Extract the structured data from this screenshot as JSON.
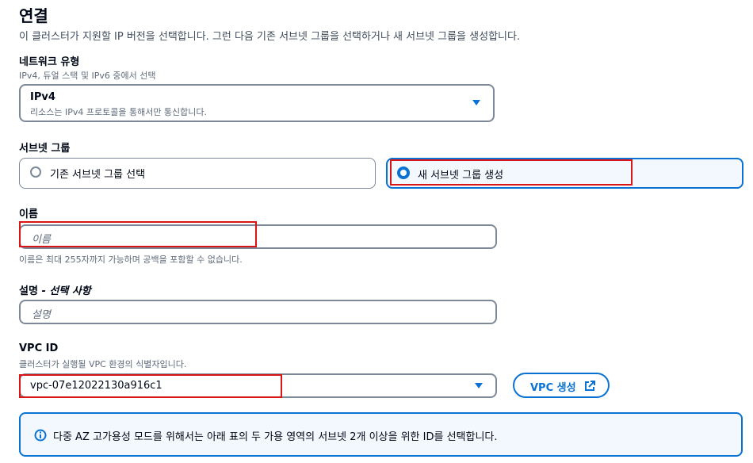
{
  "section": {
    "title": "연결",
    "description": "이 클러스터가 지원할 IP 버전을 선택합니다. 그런 다음 기존 서브넷 그룹을 선택하거나 새 서브넷 그룹을 생성합니다."
  },
  "network_type": {
    "label": "네트워크 유형",
    "sublabel": "IPv4, 듀얼 스택 및 IPv6 중에서 선택",
    "selected_value": "IPv4",
    "selected_description": "리소스는 IPv4 프로토콜을 통해서만 통신합니다.",
    "icon": "caret-down-icon"
  },
  "subnet_group": {
    "label": "서브넷 그룹",
    "options": [
      {
        "label": "기존 서브넷 그룹 선택",
        "selected": false
      },
      {
        "label": "새 서브넷 그룹 생성",
        "selected": true
      }
    ]
  },
  "name_field": {
    "label": "이름",
    "placeholder": "이름",
    "hint": "이름은 최대 255자까지 가능하며 공백을 포함할 수 없습니다."
  },
  "description_field": {
    "label": "설명",
    "label_optional": " - 선택 사항",
    "placeholder": "설명"
  },
  "vpc": {
    "label": "VPC ID",
    "sublabel": "클러스터가 실행될 VPC 환경의 식별자입니다.",
    "selected_value": "vpc-07e12022130a916c1",
    "create_button_label": "VPC 생성",
    "create_button_icon": "external-link-icon"
  },
  "info": {
    "icon": "info-icon",
    "text": "다중 AZ 고가용성 모드를 위해서는 아래 표의 두 가용 영역의 서브넷 2개 이상을 위한 ID를 선택합니다."
  },
  "colors": {
    "accent": "#0972d3",
    "highlight": "#d91515",
    "border": "#7d8998"
  }
}
